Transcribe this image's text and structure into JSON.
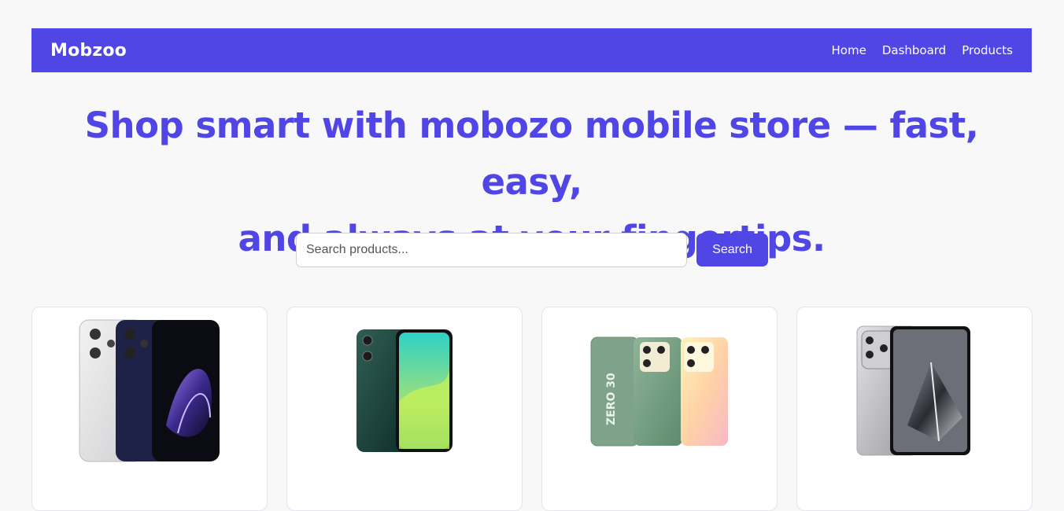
{
  "nav": {
    "brand": "Mobzoo",
    "links": [
      "Home",
      "Dashboard",
      "Products"
    ]
  },
  "hero": {
    "line1": "Shop smart with mobozo mobile store — fast, easy,",
    "line2": "and always at your fingertips."
  },
  "search": {
    "placeholder": "Search products...",
    "button_label": "Search"
  },
  "products": [
    {
      "image": "oppo-phone-white-and-navy"
    },
    {
      "image": "vivo-phone-green"
    },
    {
      "image": "infinix-zero-30-green"
    },
    {
      "image": "silver-phone-crystal-wallpaper"
    }
  ],
  "colors": {
    "accent": "#4f46e5",
    "background": "#f8f8f8"
  }
}
